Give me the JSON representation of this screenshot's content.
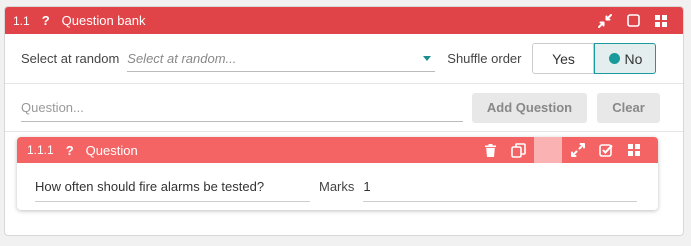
{
  "colors": {
    "outer_header": "#e04448",
    "inner_header": "#f46464",
    "accent": "#1a9a9a"
  },
  "outer": {
    "number": "1.1",
    "help_symbol": "?",
    "title": "Question bank",
    "icons": [
      "collapse-icon",
      "square-icon",
      "grid-icon"
    ]
  },
  "settings": {
    "select_label": "Select at random",
    "select_placeholder": "Select at random...",
    "shuffle_label": "Shuffle order",
    "yes_label": "Yes",
    "no_label": "No",
    "selected": "No"
  },
  "add_row": {
    "question_placeholder": "Question...",
    "add_button": "Add Question",
    "clear_button": "Clear"
  },
  "question": {
    "number": "1.1.1",
    "help_symbol": "?",
    "title": "Question",
    "icons": [
      "trash-icon",
      "copy-icon",
      "expand-icon",
      "checkbox-icon",
      "grid-icon"
    ],
    "text": "How often should fire alarms be tested?",
    "marks_label": "Marks",
    "marks_value": "1"
  }
}
